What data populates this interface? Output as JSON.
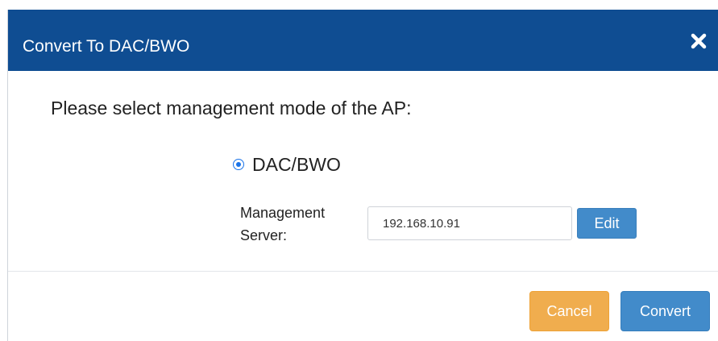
{
  "dialog": {
    "title": "Convert To DAC/BWO",
    "close_icon": "close-icon",
    "prompt": "Please select management mode of the AP:",
    "mode_option": {
      "label": "DAC/BWO",
      "selected": true
    },
    "management_server": {
      "label": "Management Server:",
      "value": "192.168.10.91",
      "edit_label": "Edit"
    },
    "footer": {
      "cancel_label": "Cancel",
      "convert_label": "Convert"
    }
  },
  "colors": {
    "header_bg": "#0f4d92",
    "primary_button": "#428bca",
    "warning_button": "#f0ad4e",
    "radio_accent": "#1a73e8"
  }
}
